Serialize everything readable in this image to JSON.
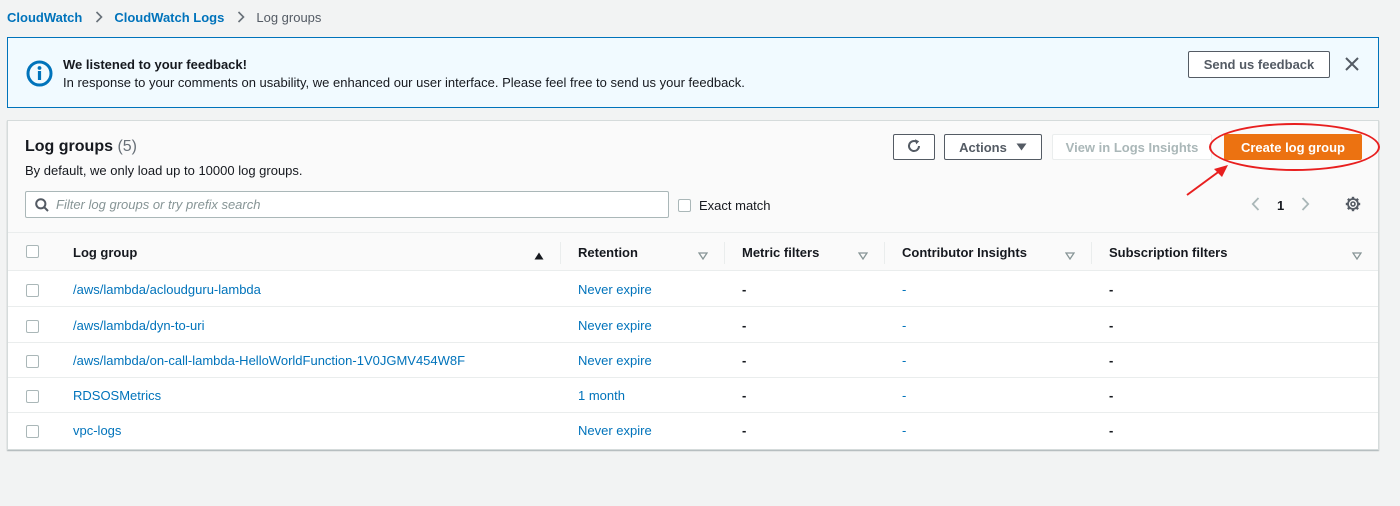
{
  "breadcrumb": {
    "items": [
      "CloudWatch",
      "CloudWatch Logs"
    ],
    "current": "Log groups"
  },
  "flash": {
    "title": "We listened to your feedback!",
    "message": "In response to your comments on usability, we enhanced our user interface. Please feel free to send us your feedback.",
    "button_label": "Send us feedback",
    "icon": "info-icon"
  },
  "panel": {
    "title": "Log groups",
    "count": "(5)",
    "description": "By default, we only load up to 10000 log groups.",
    "actions_label": "Actions",
    "insights_label": "View in Logs Insights",
    "create_label": "Create log group",
    "search_placeholder": "Filter log groups or try prefix search",
    "exact_match_label": "Exact match",
    "page": "1"
  },
  "table": {
    "columns": [
      "Log group",
      "Retention",
      "Metric filters",
      "Contributor Insights",
      "Subscription filters"
    ],
    "rows": [
      [
        "/aws/lambda/acloudguru-lambda",
        "Never expire",
        "-",
        "-",
        "-"
      ],
      [
        "/aws/lambda/dyn-to-uri",
        "Never expire",
        "-",
        "-",
        "-"
      ],
      [
        "/aws/lambda/on-call-lambda-HelloWorldFunction-1V0JGMV454W8F",
        "Never expire",
        "-",
        "-",
        "-"
      ],
      [
        "RDSOSMetrics",
        "1 month",
        "-",
        "-",
        "-"
      ],
      [
        "vpc-logs",
        "Never expire",
        "-",
        "-",
        "-"
      ]
    ]
  },
  "colors": {
    "link": "#0073bb",
    "primary": "#ec7211",
    "annotation": "#e81f1f",
    "banner_bg": "#f1faff"
  }
}
